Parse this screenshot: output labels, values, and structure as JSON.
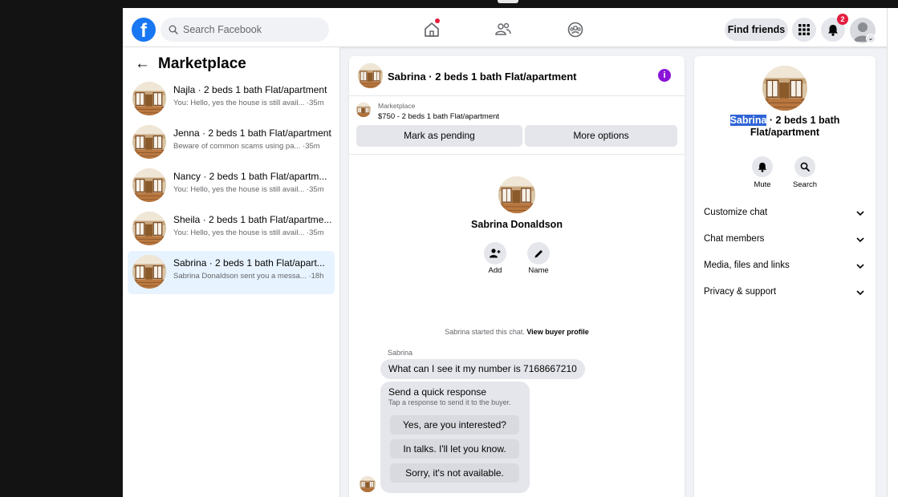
{
  "topbar": {
    "logo": "f",
    "search_placeholder": "Search Facebook",
    "find_friends": "Find friends",
    "notification_count": "2"
  },
  "marketplace": {
    "back_arrow": "←",
    "title": "Marketplace",
    "conversations": [
      {
        "title": "Najla · 2 beds 1 bath Flat/apartment",
        "subtitle": "You: Hello, yes the house is still avail... ·35m",
        "active": false
      },
      {
        "title": "Jenna · 2 beds 1 bath Flat/apartment",
        "subtitle": "Beware of common scams using pa... ·35m",
        "active": false
      },
      {
        "title": "Nancy · 2 beds 1 bath Flat/apartm...",
        "subtitle": "You: Hello, yes the house is still avail... ·35m",
        "active": false
      },
      {
        "title": "Sheila · 2 beds 1 bath Flat/apartme...",
        "subtitle": "You: Hello, yes the house is still avail... ·35m",
        "active": false
      },
      {
        "title": "Sabrina · 2 beds 1 bath Flat/apart...",
        "subtitle": "Sabrina Donaldson sent you a messa... ·18h",
        "active": true
      }
    ]
  },
  "chat": {
    "header_title": "Sabrina · 2 beds 1 bath Flat/apartment",
    "info_icon": "i",
    "listing_source": "Marketplace",
    "listing_price": "$750 - 2 beds 1 bath Flat/apartment",
    "mark_pending": "Mark as pending",
    "more_options": "More options",
    "profile_name": "Sabrina Donaldson",
    "add_label": "Add",
    "name_label": "Name",
    "started_text": "Sabrina started this chat. ",
    "view_buyer": "View buyer profile",
    "sender": "Sabrina",
    "message": "What can I see it my number is 7168667210",
    "quick_title": "Send a quick response",
    "quick_subtitle": "Tap a response to send it to the buyer.",
    "quick_options": [
      "Yes, are you interested?",
      "In talks. I'll let you know.",
      "Sorry, it's not available."
    ]
  },
  "details": {
    "title_highlight": "Sabrina",
    "title_rest": " · 2 beds 1 bath",
    "title_line2": "Flat/apartment",
    "mute_label": "Mute",
    "search_label": "Search",
    "sections": [
      "Customize chat",
      "Chat members",
      "Media, files and links",
      "Privacy & support"
    ]
  },
  "colors": {
    "facebook_blue": "#1877f2",
    "badge_red": "#e41e3f",
    "info_purple": "#8a14d9",
    "selected_highlight": "#2f64d6",
    "active_row": "#e7f3ff"
  }
}
